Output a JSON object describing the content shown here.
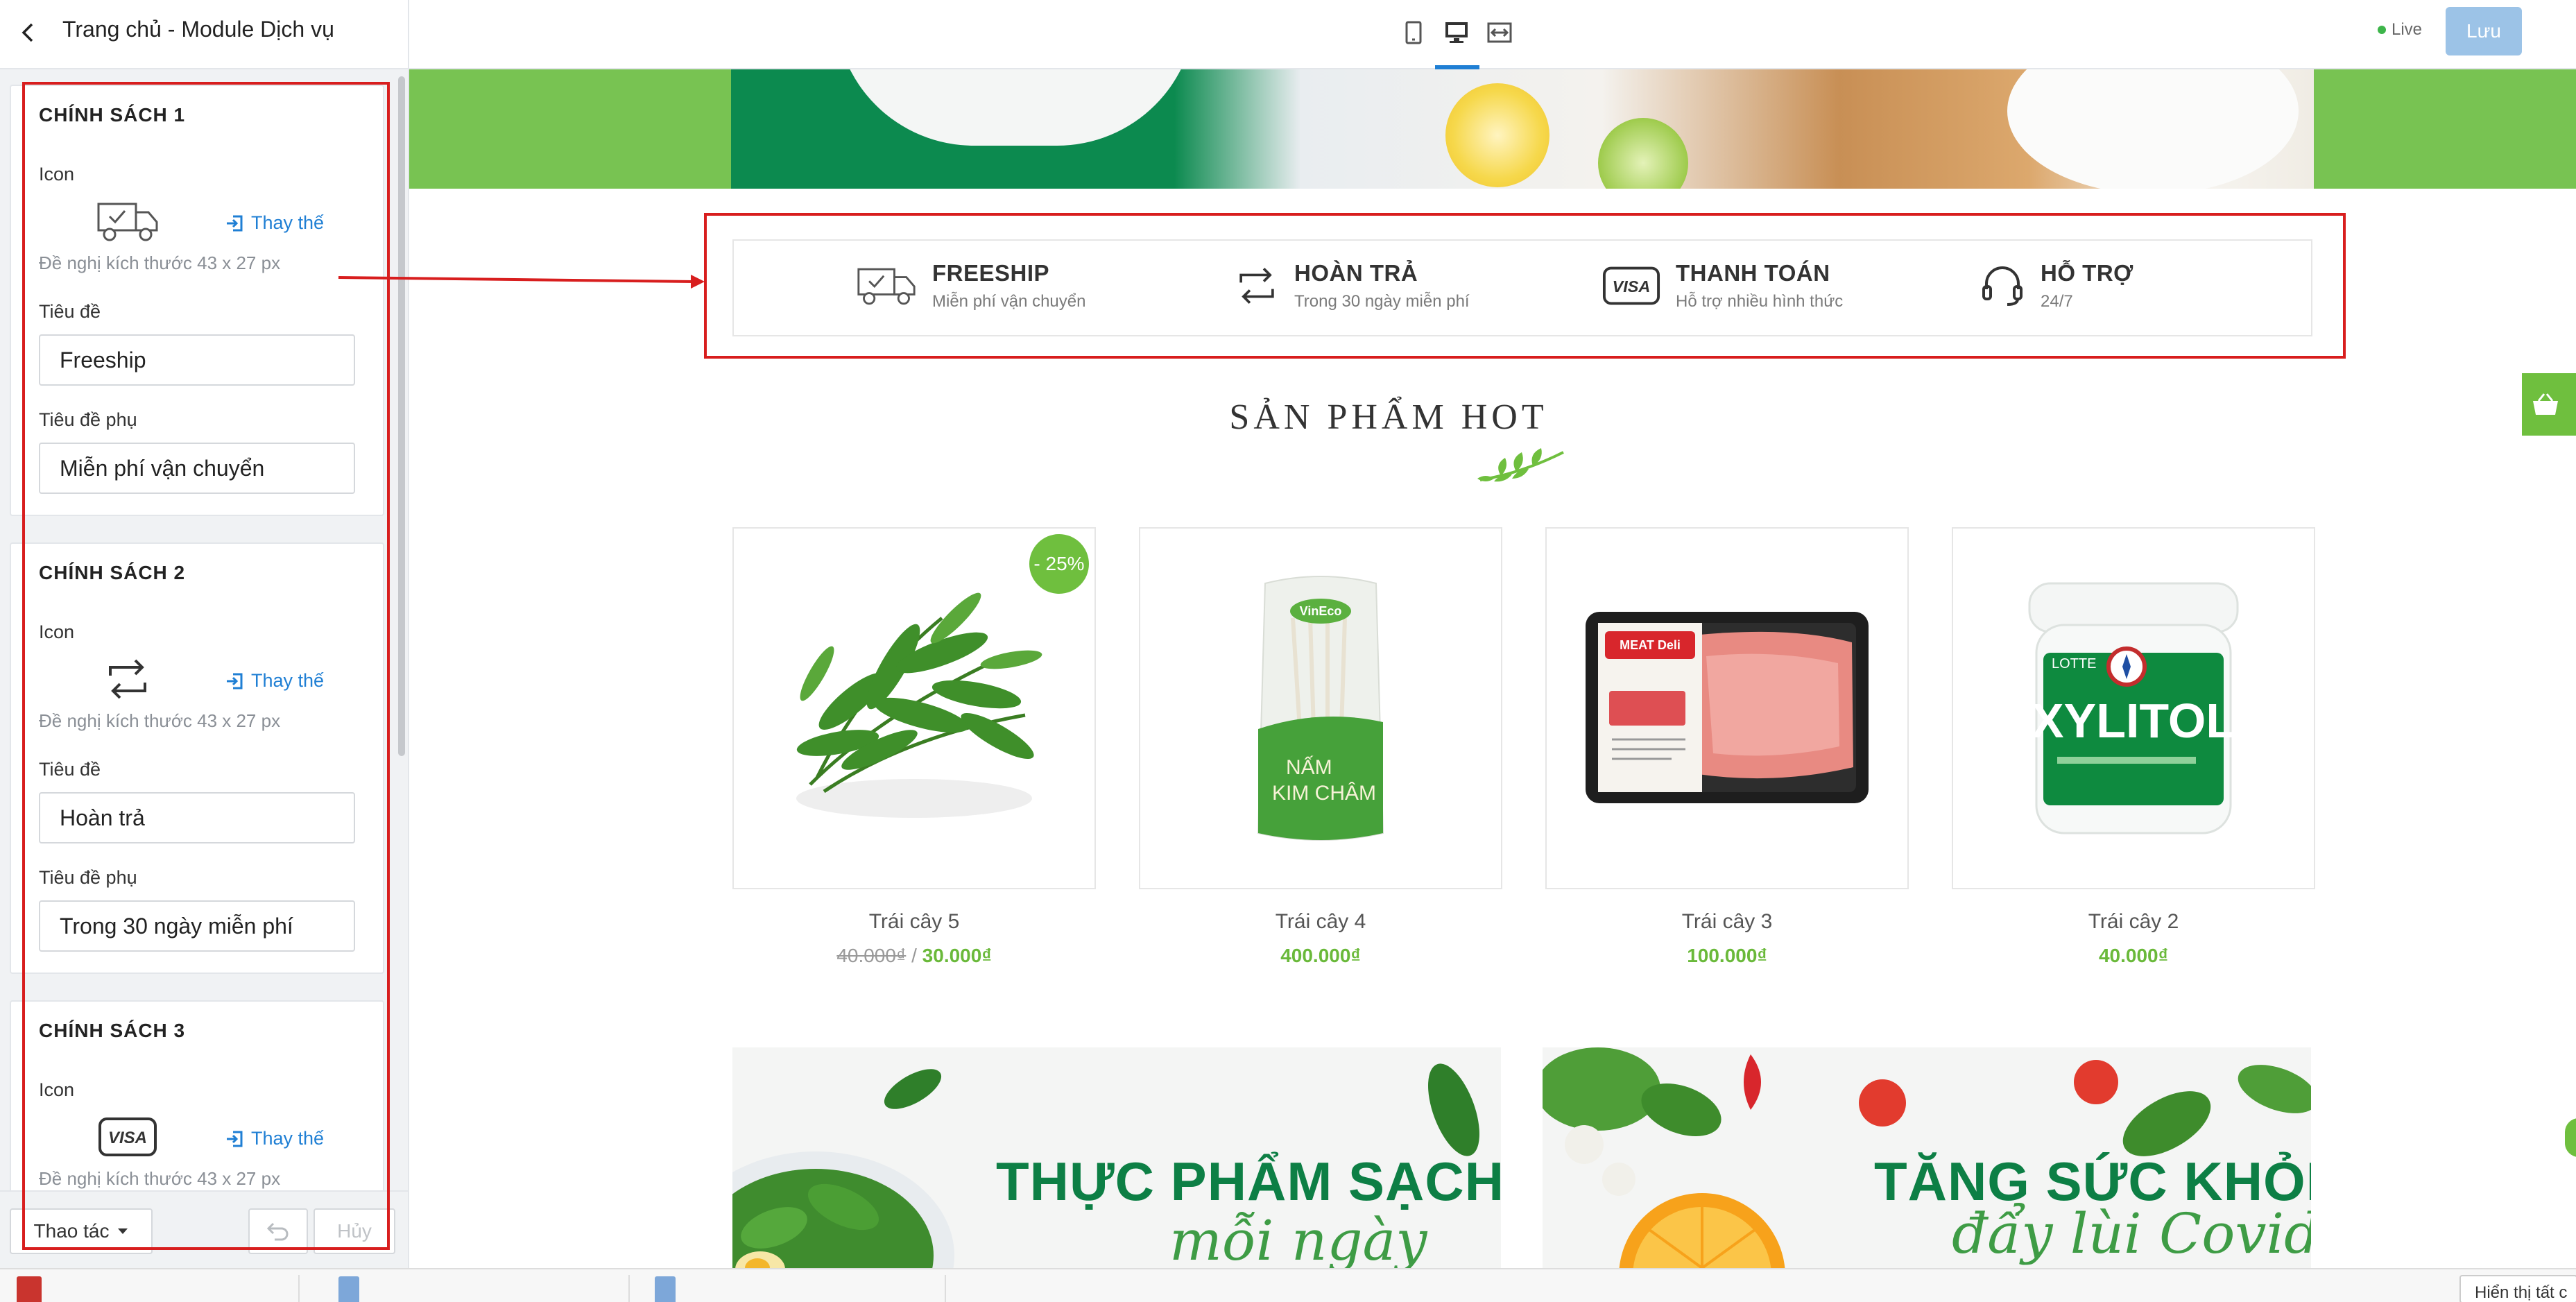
{
  "header": {
    "title": "Trang chủ - Module Dịch vụ",
    "live_label": "Live",
    "save_label": "Lưu",
    "devices": [
      "mobile-icon",
      "desktop-icon",
      "fullwidth-icon"
    ]
  },
  "sidebar": {
    "policies": [
      {
        "heading": "CHÍNH SÁCH 1",
        "icon_label": "Icon",
        "icon": "truck-icon",
        "replace_label": "Thay thế",
        "hint": "Đề nghị kích thước 43 x 27 px",
        "title_label": "Tiêu đề",
        "title_value": "Freeship",
        "subtitle_label": "Tiêu đề phụ",
        "subtitle_value": "Miễn phí vận chuyển"
      },
      {
        "heading": "CHÍNH SÁCH 2",
        "icon_label": "Icon",
        "icon": "return-arrows-icon",
        "replace_label": "Thay thế",
        "hint": "Đề nghị kích thước 43 x 27 px",
        "title_label": "Tiêu đề",
        "title_value": "Hoàn trả",
        "subtitle_label": "Tiêu đề phụ",
        "subtitle_value": "Trong 30 ngày miễn phí"
      },
      {
        "heading": "CHÍNH SÁCH 3",
        "icon_label": "Icon",
        "icon": "visa-card-icon",
        "replace_label": "Thay thế",
        "hint": "Đề nghị kích thước 43 x 27 px"
      }
    ],
    "footer": {
      "actions_label": "Thao tác",
      "cancel_label": "Hủy"
    }
  },
  "preview": {
    "policy_bar": [
      {
        "title": "FREESHIP",
        "subtitle": "Miễn phí vận chuyển",
        "icon": "truck-icon"
      },
      {
        "title": "HOÀN TRẢ",
        "subtitle": "Trong 30 ngày miễn phí",
        "icon": "return-arrows-icon"
      },
      {
        "title": "THANH TOÁN",
        "subtitle": "Hỗ trợ nhiều hình thức",
        "icon": "visa-card-icon"
      },
      {
        "title": "HỖ TRỢ",
        "subtitle": "24/7",
        "icon": "headset-icon"
      }
    ],
    "section_title": "SẢN PHẨM HOT",
    "products": [
      {
        "name": "Trái cây 5",
        "old_price": "40.000₫",
        "separator": "/",
        "price": "30.000₫",
        "badge": "- 25%"
      },
      {
        "name": "Trái cây 4",
        "price": "400.000₫"
      },
      {
        "name": "Trái cây 3",
        "price": "100.000₫"
      },
      {
        "name": "Trái cây 2",
        "price": "40.000₫"
      }
    ],
    "product_image_text": {
      "mushroom_brand": "VinEco",
      "mushroom_label_line1": "NẤM",
      "mushroom_label_line2": "KIM CHÂM",
      "meat_brand": "MEAT Deli",
      "gum_brand": "LOTTE",
      "gum_name": "XYLITOL"
    },
    "banners": [
      {
        "headline": "THỰC PHẨM SẠCH",
        "script": "mỗi ngày"
      },
      {
        "headline": "TĂNG SỨC KHỎE",
        "script": "đẩy lùi Covid"
      }
    ]
  },
  "taskbar": {
    "right_label": "Hiển thị tất c"
  },
  "colors": {
    "accent_blue": "#1f7fd4",
    "brand_green": "#6fbf3e",
    "highlight_red": "#d81e1e",
    "hero_green": "#0c8a4f"
  }
}
